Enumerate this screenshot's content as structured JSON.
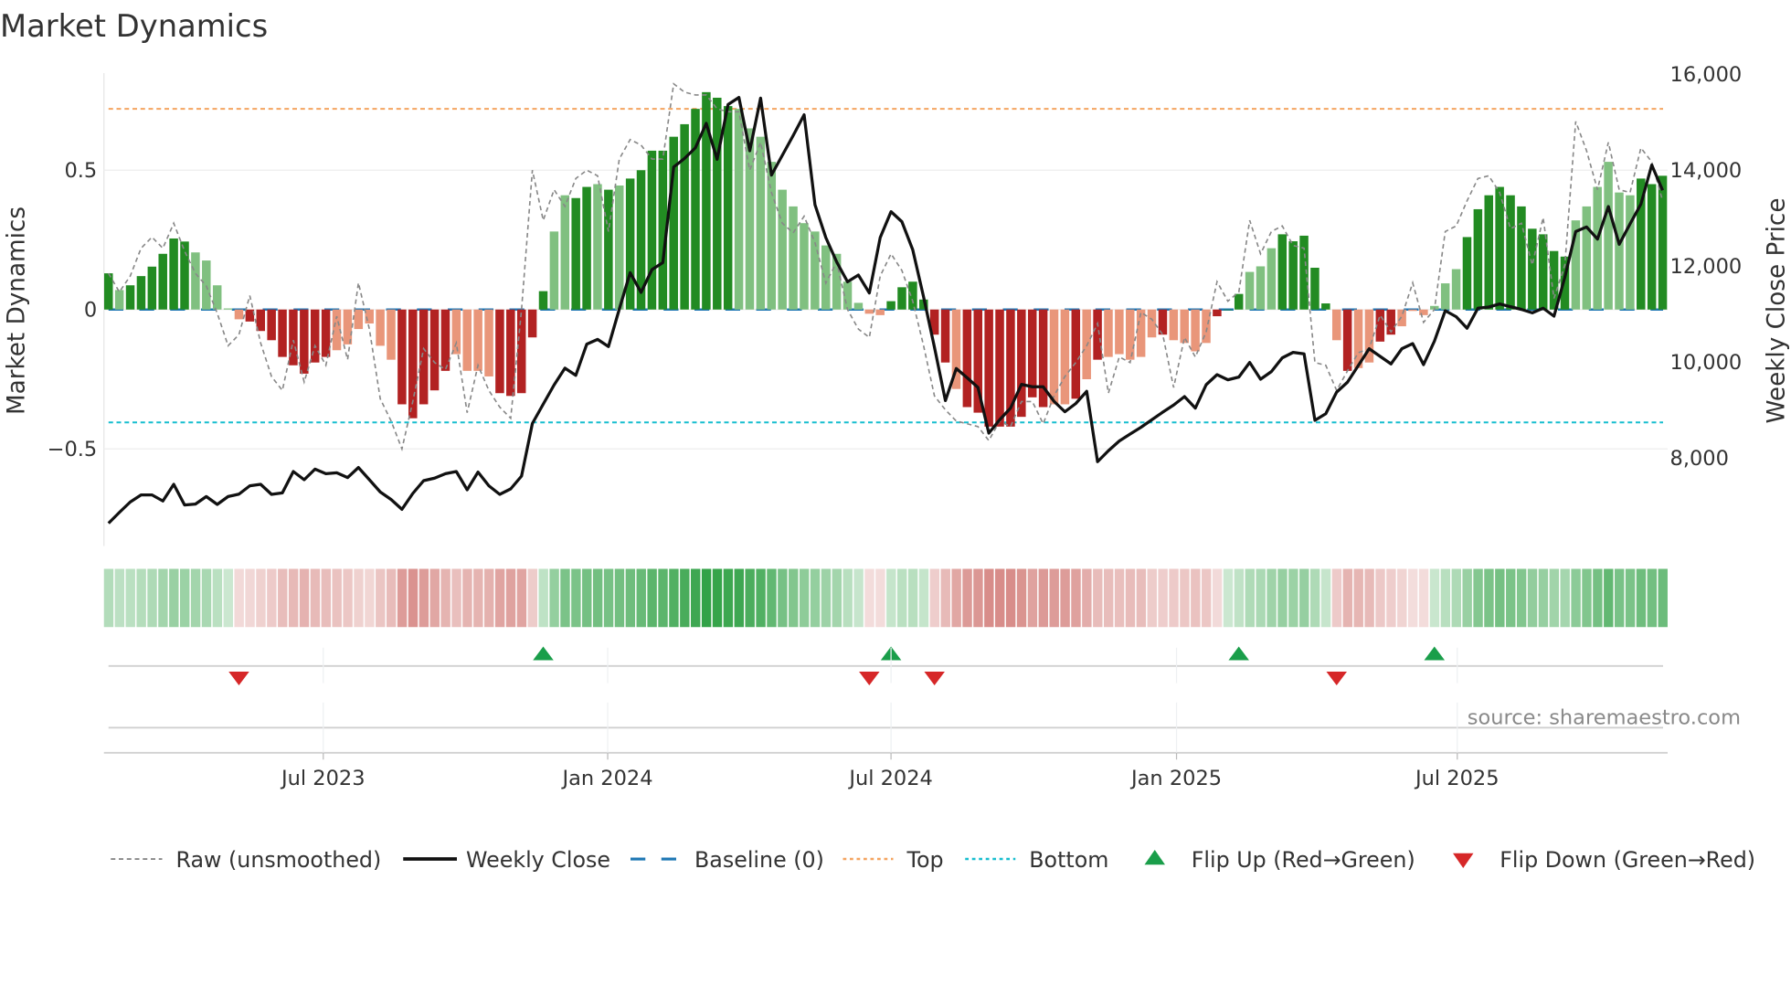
{
  "chart_data": {
    "type": "bar",
    "title": "Market Dynamics",
    "ylabel": "Market Dynamics",
    "y2label": "Weekly Close Price",
    "ylim": [
      -0.78,
      0.85
    ],
    "y2lim": [
      6000,
      16000
    ],
    "y_ticks": [
      {
        "v": 0.5,
        "label": "0.5"
      },
      {
        "v": 0,
        "label": "0"
      },
      {
        "v": -0.5,
        "label": "−0.5"
      }
    ],
    "y2_ticks": [
      {
        "v": 16000,
        "label": "16,000"
      },
      {
        "v": 14000,
        "label": "14,000"
      },
      {
        "v": 12000,
        "label": "12,000"
      },
      {
        "v": 10000,
        "label": "10,000"
      },
      {
        "v": 8000,
        "label": "8,000"
      }
    ],
    "x_ticks": [
      {
        "week": 19.76,
        "label": "Jul 2023"
      },
      {
        "week": 45.93,
        "label": "Jan 2024"
      },
      {
        "week": 72.0,
        "label": "Jul 2024"
      },
      {
        "week": 98.27,
        "label": "Jan 2025"
      },
      {
        "week": 124.1,
        "label": "Jul 2025"
      }
    ],
    "levels": {
      "baseline": 0,
      "top": 0.72,
      "bottom": -0.405
    },
    "colors": {
      "green_strong": "#228b22",
      "green_fading": "#80c080",
      "red_strong": "#b22222",
      "red_fading": "#e9967a",
      "raw": "#888888",
      "close": "#111111",
      "baseline": "#1f77b4",
      "top": "#f4a460",
      "bottom": "#17becf",
      "flip_up": "#1a9e4a",
      "flip_down": "#d62728"
    },
    "series": [
      {
        "name": "Market Dynamics (smoothed bars)",
        "values": [
          0.13,
          0.07,
          0.087,
          0.12,
          0.154,
          0.2,
          0.255,
          0.244,
          0.205,
          0.176,
          0.087,
          0.004,
          -0.035,
          -0.043,
          -0.077,
          -0.11,
          -0.17,
          -0.2,
          -0.23,
          -0.19,
          -0.17,
          -0.146,
          -0.125,
          -0.07,
          -0.05,
          -0.13,
          -0.18,
          -0.34,
          -0.39,
          -0.34,
          -0.29,
          -0.22,
          -0.16,
          -0.22,
          -0.22,
          -0.24,
          -0.3,
          -0.31,
          -0.3,
          -0.1,
          0.066,
          0.28,
          0.41,
          0.4,
          0.44,
          0.45,
          0.43,
          0.445,
          0.47,
          0.5,
          0.57,
          0.57,
          0.62,
          0.665,
          0.72,
          0.78,
          0.76,
          0.73,
          0.72,
          0.65,
          0.62,
          0.53,
          0.43,
          0.37,
          0.31,
          0.28,
          0.23,
          0.2,
          0.1,
          0.024,
          -0.015,
          -0.02,
          0.03,
          0.08,
          0.1,
          0.036,
          -0.09,
          -0.19,
          -0.285,
          -0.35,
          -0.37,
          -0.42,
          -0.42,
          -0.42,
          -0.385,
          -0.315,
          -0.35,
          -0.34,
          -0.34,
          -0.32,
          -0.25,
          -0.18,
          -0.17,
          -0.16,
          -0.18,
          -0.17,
          -0.1,
          -0.09,
          -0.11,
          -0.12,
          -0.15,
          -0.12,
          -0.024,
          0,
          0.056,
          0.135,
          0.155,
          0.22,
          0.27,
          0.245,
          0.265,
          0.15,
          0.022,
          -0.11,
          -0.22,
          -0.21,
          -0.19,
          -0.115,
          -0.09,
          -0.06,
          -0.005,
          -0.02,
          0.013,
          0.094,
          0.145,
          0.26,
          0.36,
          0.41,
          0.44,
          0.41,
          0.37,
          0.29,
          0.27,
          0.21,
          0.19,
          0.32,
          0.37,
          0.44,
          0.53,
          0.42,
          0.41,
          0.47,
          0.45,
          0.48
        ],
        "shade": "dlddddddlllllddddddddlllllldddddlllldddddllddldlddddddddddllllllllllllllddddddlddddddddlldldllllldlllldddllldddddldllddllllllddddddddddllllllddddlldld"
      },
      {
        "name": "Raw (unsmoothed)",
        "values": [
          0.13,
          0.063,
          0.12,
          0.22,
          0.26,
          0.22,
          0.31,
          0.21,
          0.13,
          0.085,
          -0.013,
          -0.13,
          -0.09,
          0.05,
          -0.12,
          -0.24,
          -0.29,
          -0.11,
          -0.26,
          -0.13,
          -0.2,
          -0.024,
          -0.18,
          0.096,
          -0.07,
          -0.32,
          -0.4,
          -0.5,
          -0.33,
          -0.14,
          -0.19,
          -0.215,
          -0.12,
          -0.37,
          -0.2,
          -0.29,
          -0.35,
          -0.39,
          0,
          0.5,
          0.32,
          0.43,
          0.37,
          0.47,
          0.5,
          0.48,
          0.28,
          0.54,
          0.61,
          0.59,
          0.54,
          0.54,
          0.81,
          0.78,
          0.77,
          0.77,
          0.72,
          0.71,
          0.71,
          0.5,
          0.6,
          0.42,
          0.31,
          0.275,
          0.335,
          0.24,
          0.095,
          0.17,
          0,
          -0.07,
          -0.1,
          0.12,
          0.2,
          0.14,
          0.03,
          -0.13,
          -0.31,
          -0.36,
          -0.4,
          -0.41,
          -0.42,
          -0.47,
          -0.4,
          -0.42,
          -0.33,
          -0.33,
          -0.41,
          -0.31,
          -0.24,
          -0.19,
          -0.13,
          -0.05,
          -0.3,
          -0.17,
          -0.19,
          -0.01,
          -0.035,
          -0.09,
          -0.28,
          -0.1,
          -0.17,
          -0.08,
          0.1,
          0.03,
          0.063,
          0.32,
          0.2,
          0.28,
          0.3,
          0.23,
          0.22,
          -0.19,
          -0.2,
          -0.29,
          -0.22,
          -0.155,
          -0.14,
          -0.02,
          -0.08,
          -0.024,
          0.096,
          -0.046,
          0,
          0.28,
          0.3,
          0.39,
          0.47,
          0.48,
          0.42,
          0.29,
          0.31,
          0.16,
          0.33,
          0.04,
          0.16,
          0.675,
          0.57,
          0.43,
          0.6,
          0.43,
          0.42,
          0.58,
          0.53,
          0.39
        ]
      },
      {
        "name": "Weekly Close",
        "axis": "right",
        "values": [
          6616,
          6844,
          7060,
          7206,
          7206,
          7080,
          7429,
          6997,
          7016,
          7175,
          7010,
          7175,
          7225,
          7397,
          7429,
          7219,
          7251,
          7695,
          7524,
          7746,
          7651,
          7670,
          7568,
          7778,
          7524,
          7270,
          7111,
          6908,
          7238,
          7505,
          7556,
          7651,
          7695,
          7314,
          7683,
          7397,
          7219,
          7333,
          7600,
          8698,
          9100,
          9500,
          9850,
          9700,
          10350,
          10450,
          10300,
          11080,
          11841,
          11429,
          11905,
          12051,
          14044,
          14222,
          14444,
          14952,
          14203,
          15346,
          15492,
          14381,
          15479,
          13873,
          14286,
          14698,
          15130,
          13257,
          12571,
          12064,
          11651,
          11791,
          11416,
          12571,
          13111,
          12902,
          12317,
          11333,
          10286,
          9175,
          9842,
          9651,
          9448,
          8496,
          8775,
          9016,
          9512,
          9461,
          9461,
          9156,
          8940,
          9112,
          9366,
          7900,
          8128,
          8331,
          8477,
          8617,
          8775,
          8934,
          9080,
          9258,
          9016,
          9505,
          9715,
          9607,
          9664,
          9969,
          9620,
          9778,
          10064,
          10178,
          10147,
          8762,
          8900,
          9350,
          9556,
          9905,
          10254,
          10095,
          9937,
          10254,
          10362,
          9924,
          10413,
          11048,
          10921,
          10680,
          11099,
          11124,
          11187,
          11130,
          11073,
          11003,
          11099,
          10933,
          11746,
          12698,
          12794,
          12540,
          13219,
          12432,
          12857,
          13270,
          14083,
          13556
        ]
      }
    ],
    "flip_up_weeks": [
      40,
      72,
      104,
      122
    ],
    "flip_down_weeks": [
      12,
      70,
      76,
      113
    ]
  },
  "legend": {
    "raw": "Raw (unsmoothed)",
    "close": "Weekly Close",
    "baseline": "Baseline (0)",
    "top": "Top",
    "bottom": "Bottom",
    "flip_up": "Flip Up (Red→Green)",
    "flip_down": "Flip Down (Green→Red)"
  },
  "source": "source: sharemaestro.com"
}
